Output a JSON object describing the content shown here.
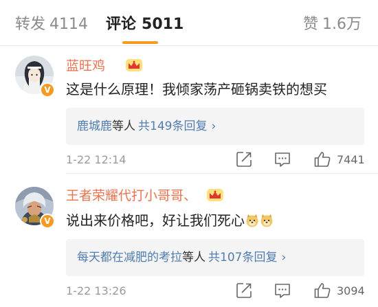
{
  "tabs": {
    "repost": {
      "label": "转发",
      "count": "4114"
    },
    "comment": {
      "label": "评论",
      "count": "5011"
    },
    "like": {
      "label": "赞",
      "count": "1.6万"
    }
  },
  "colors": {
    "accent": "#f59b23",
    "username": "#eb7350",
    "link": "#507daf",
    "reply_bg": "#f4f4f4"
  },
  "comments": [
    {
      "username": "蓝旺鸡",
      "badge_icon": "crown-icon",
      "verified_icon": "verified-v-icon",
      "text": "这是什么原理！我倾家荡产砸锅卖铁的想买",
      "emojis": [],
      "replies": {
        "names": "鹿城鹿",
        "suffix": "等人",
        "count_text": "共149条回复",
        "chevron": "›"
      },
      "time": "1-22 12:14",
      "likes": "7441"
    },
    {
      "username": "王者荣耀代打小哥哥、",
      "badge_icon": "crown-icon",
      "verified_icon": "verified-v-icon",
      "text": "说出来价格吧，好让我们死心",
      "emojis": [
        "doge-emoji",
        "doge-emoji"
      ],
      "replies": {
        "names": "每天都在减肥的考拉",
        "suffix": "等人",
        "count_text": "共107条回复",
        "chevron": "›"
      },
      "time": "1-22 13:26",
      "likes": "3094"
    }
  ]
}
